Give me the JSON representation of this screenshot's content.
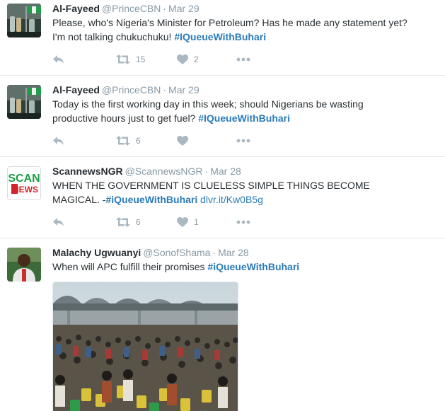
{
  "tweets": [
    {
      "name": "Al-Fayeed",
      "handle": "@PrinceCBN",
      "sep": "·",
      "date": "Mar 29",
      "line1": "Please, who's Nigeria's Minister for Petroleum? Has he made any statement yet?",
      "line2_text": "I'm not talking chukuchuku! ",
      "line2_hashtag": "#IQueueWithBuhari",
      "retweets": "15",
      "likes": "2",
      "avatar_icon": "avatar-flag-bottles"
    },
    {
      "name": "Al-Fayeed",
      "handle": "@PrinceCBN",
      "sep": "·",
      "date": "Mar 29",
      "line1": "Today is the first working day in this week; should Nigerians be  wasting",
      "line2_text": "productive hours just to get fuel? ",
      "line2_hashtag": "#IQueueWithBuhari",
      "retweets": "6",
      "likes": "",
      "avatar_icon": "avatar-flag-bottles"
    },
    {
      "name": "ScannewsNGR",
      "handle": "@ScannewsNGR",
      "sep": "·",
      "date": "Mar 28",
      "line1": "WHEN THE GOVERNMENT IS CLUELESS SIMPLE THINGS BECOME",
      "line2_text": "MAGICAL. -",
      "line2_hashtag": "#iQueueWithBuhari",
      "line2_link": "dlvr.it/Kw0B5g",
      "retweets": "6",
      "likes": "1",
      "avatar_logo_top": "SCAN",
      "avatar_logo_bottom": "NEWS"
    },
    {
      "name": "Malachy Ugwuanyi",
      "handle": "@SonofShama",
      "sep": "·",
      "date": "Mar 28",
      "line1_text": "When will APC fulfill their promises ",
      "line1_hashtag": "#iQueueWithBuhari",
      "media": "photo-fuel-station-queue"
    }
  ],
  "icons": {
    "reply": "reply-icon",
    "retweet": "retweet-icon",
    "like": "heart-icon",
    "more": "more-icon"
  },
  "colors": {
    "text": "#292f33",
    "muted": "#8899a6",
    "link": "#2b7bb9",
    "divider": "#e1e8ed"
  }
}
